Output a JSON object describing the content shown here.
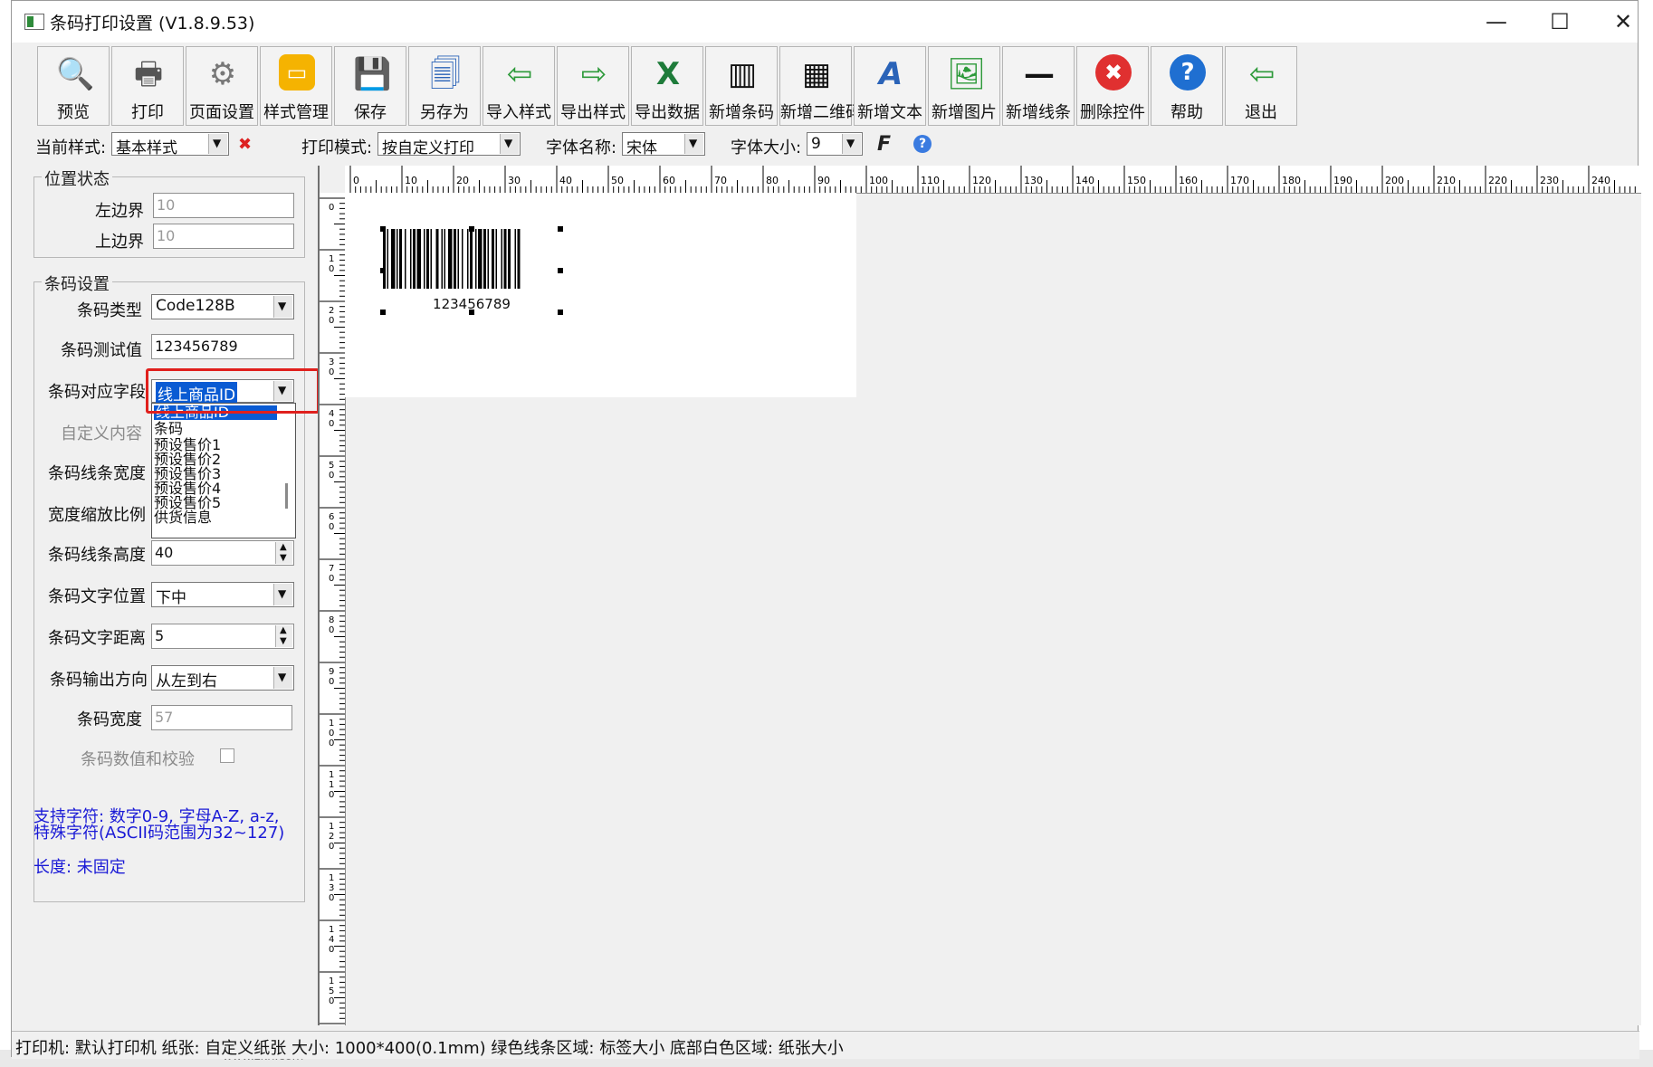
{
  "window": {
    "title": "条码打印设置 (V1.8.9.53)",
    "controls": {
      "minimize": "—",
      "maximize": "☐",
      "close": "✕"
    }
  },
  "toolbar": {
    "buttons": [
      {
        "label": "预览",
        "icon": "magnifier-document-icon",
        "glyph": "🔍"
      },
      {
        "label": "打印",
        "icon": "printer-icon",
        "glyph": "🖶"
      },
      {
        "label": "页面设置",
        "icon": "gear-icon",
        "glyph": "⚙"
      },
      {
        "label": "样式管理",
        "icon": "folder-icon",
        "glyph": "▭"
      },
      {
        "label": "保存",
        "icon": "floppy-disk-icon",
        "glyph": "💾"
      },
      {
        "label": "另存为",
        "icon": "save-as-icon",
        "glyph": "🗐"
      },
      {
        "label": "导入样式",
        "icon": "import-icon",
        "glyph": "⇦"
      },
      {
        "label": "导出样式",
        "icon": "export-icon",
        "glyph": "⇨"
      },
      {
        "label": "导出数据",
        "icon": "excel-icon",
        "glyph": "X"
      },
      {
        "label": "新增条码",
        "icon": "barcode-add-icon",
        "glyph": "▥"
      },
      {
        "label": "新增二维码",
        "icon": "qrcode-add-icon",
        "glyph": "▦"
      },
      {
        "label": "新增文本",
        "icon": "text-add-icon",
        "glyph": "A"
      },
      {
        "label": "新增图片",
        "icon": "image-add-icon",
        "glyph": "🖼"
      },
      {
        "label": "新增线条",
        "icon": "line-add-icon",
        "glyph": "—"
      },
      {
        "label": "删除控件",
        "icon": "delete-icon",
        "glyph": "✖"
      },
      {
        "label": "帮助",
        "icon": "help-icon",
        "glyph": "?"
      },
      {
        "label": "退出",
        "icon": "exit-door-icon",
        "glyph": "⇦"
      }
    ]
  },
  "options": {
    "current_style_label": "当前样式:",
    "current_style_value": "基本样式",
    "print_mode_label": "打印模式:",
    "print_mode_value": "按自定义打印",
    "font_name_label": "字体名称:",
    "font_name_value": "宋体",
    "font_size_label": "字体大小:",
    "font_size_value": "9",
    "bold_glyph": "F",
    "help_glyph": "?"
  },
  "position": {
    "title": "位置状态",
    "left_label": "左边界",
    "left_value": "10",
    "top_label": "上边界",
    "top_value": "10"
  },
  "barcode": {
    "title": "条码设置",
    "type_label": "条码类型",
    "type_value": "Code128B",
    "test_label": "条码测试值",
    "test_value": "123456789",
    "field_label": "条码对应字段",
    "field_value": "线上商品ID",
    "field_options": [
      "线上商品ID",
      "条码",
      "预设售价1",
      "预设售价2",
      "预设售价3",
      "预设售价4",
      "预设售价5",
      "供货信息"
    ],
    "custom_label": "自定义内容",
    "line_width_label": "条码线条宽度",
    "scale_label": "宽度缩放比例",
    "height_label": "条码线条高度",
    "height_value": "40",
    "text_pos_label": "条码文字位置",
    "text_pos_value": "下中",
    "text_dist_label": "条码文字距离",
    "text_dist_value": "5",
    "direction_label": "条码输出方向",
    "direction_value": "从左到右",
    "width_label": "条码宽度",
    "width_value": "57",
    "checksum_label": "条码数值和校验"
  },
  "info": {
    "line1": "支持字符: 数字0-9, 字母A-Z, a-z,",
    "line2": "特殊字符(ASCII码范围为32~127)",
    "line3": "长度: 未固定"
  },
  "canvas": {
    "barcode_text": "123456789"
  },
  "statusbar": {
    "text": "打印机: 默认打印机  纸张: 自定义纸张  大小: 1000*400(0.1mm)  绿色线条区域: 标签大小  底部白色区域: 纸张大小"
  },
  "background": {
    "left_text": "www.zkh.com"
  }
}
